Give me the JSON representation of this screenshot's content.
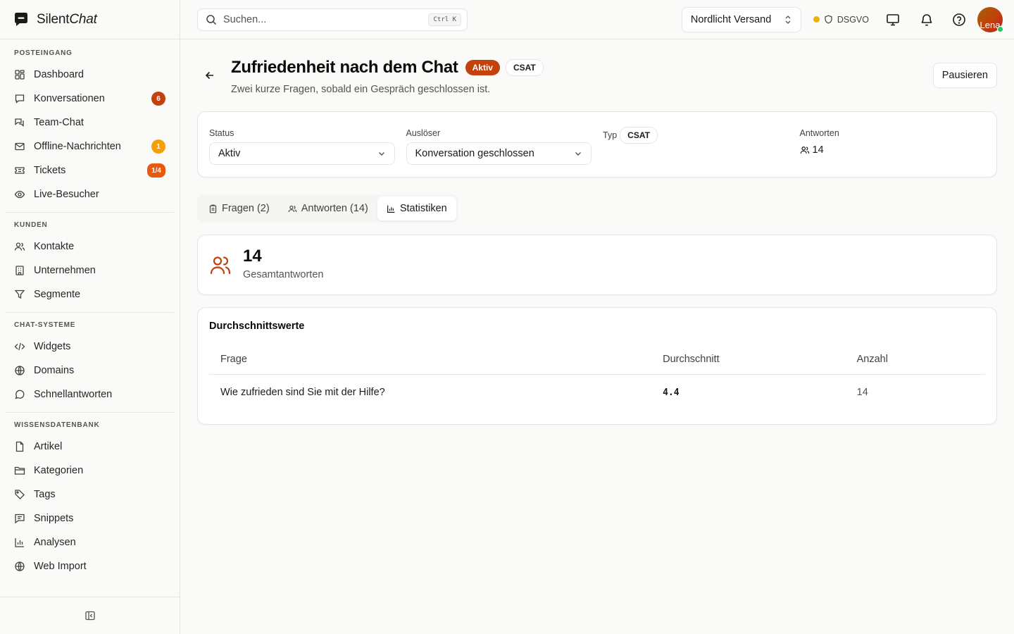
{
  "app": {
    "name_plain": "Silent",
    "name_italic": "Chat"
  },
  "sidebar": {
    "groups": [
      {
        "label": "POSTEINGANG",
        "items": [
          {
            "label": "Dashboard",
            "icon": "dashboard-icon"
          },
          {
            "label": "Konversationen",
            "icon": "chat-icon",
            "badge": "6"
          },
          {
            "label": "Team-Chat",
            "icon": "team-chat-icon"
          },
          {
            "label": "Offline-Nachrichten",
            "icon": "mail-icon",
            "badge": "1"
          },
          {
            "label": "Tickets",
            "icon": "ticket-icon",
            "badge": "1/4"
          },
          {
            "label": "Live-Besucher",
            "icon": "eye-icon"
          }
        ]
      },
      {
        "label": "KUNDEN",
        "items": [
          {
            "label": "Kontakte",
            "icon": "users-icon"
          },
          {
            "label": "Unternehmen",
            "icon": "building-icon"
          },
          {
            "label": "Segmente",
            "icon": "filter-icon"
          }
        ]
      },
      {
        "label": "CHAT-SYSTEME",
        "items": [
          {
            "label": "Widgets",
            "icon": "code-icon"
          },
          {
            "label": "Domains",
            "icon": "globe-icon"
          },
          {
            "label": "Schnellantworten",
            "icon": "message-circle-icon"
          }
        ]
      },
      {
        "label": "WISSENSDATENBANK",
        "items": [
          {
            "label": "Artikel",
            "icon": "file-icon"
          },
          {
            "label": "Kategorien",
            "icon": "folder-icon"
          },
          {
            "label": "Tags",
            "icon": "tag-icon"
          },
          {
            "label": "Snippets",
            "icon": "message-square-icon"
          },
          {
            "label": "Analysen",
            "icon": "bar-chart-icon"
          },
          {
            "label": "Web Import",
            "icon": "globe-icon"
          }
        ]
      }
    ]
  },
  "topbar": {
    "search_placeholder": "Suchen...",
    "search_shortcut": "Ctrl K",
    "org": "Nordlicht Versand",
    "gdpr": "DSGVO",
    "avatar_text": "Lena"
  },
  "page": {
    "title": "Zufriedenheit nach dem Chat",
    "status_pill": "Aktiv",
    "type_pill": "CSAT",
    "subtitle": "Zwei kurze Fragen, sobald ein Gespräch geschlossen ist.",
    "pause_button": "Pausieren"
  },
  "info": {
    "status_label": "Status",
    "status_value": "Aktiv",
    "trigger_label": "Auslöser",
    "trigger_value": "Konversation geschlossen",
    "type_label": "Typ",
    "type_value": "CSAT",
    "responses_label": "Antworten",
    "responses_value": "14"
  },
  "tabs": [
    {
      "label": "Fragen (2)",
      "icon": "clipboard-icon"
    },
    {
      "label": "Antworten (14)",
      "icon": "users-icon"
    },
    {
      "label": "Statistiken",
      "icon": "bar-chart-icon",
      "active": true
    }
  ],
  "stats": {
    "total": "14",
    "total_label": "Gesamtantworten"
  },
  "averages": {
    "title": "Durchschnittswerte",
    "columns": [
      "Frage",
      "Durchschnitt",
      "Anzahl"
    ],
    "rows": [
      {
        "question": "Wie zufrieden sind Sie mit der Hilfe?",
        "avg": "4.4",
        "count": "14"
      }
    ]
  },
  "colors": {
    "accent": "#c2410c",
    "badge_amber": "#f59e0b",
    "online": "#22c55e",
    "gdpr_dot": "#eab308"
  }
}
